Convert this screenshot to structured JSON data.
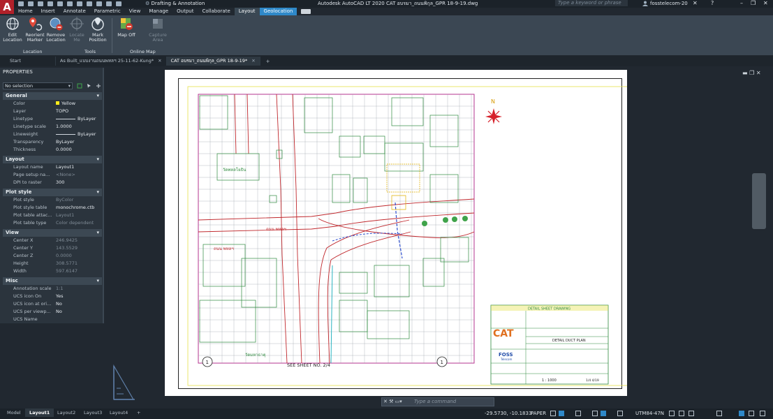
{
  "title_bar": {
    "app_title": "Autodesk AutoCAD LT 2020   CAT อบรมา_ถนนพิกุล_GPR 18-9-19.dwg",
    "workspace": "Drafting & Annotation",
    "search_placeholder": "Type a keyword or phrase",
    "user": "fosstelecom-20",
    "logo_letter": "A"
  },
  "ribbon_tabs": [
    {
      "label": "Home"
    },
    {
      "label": "Insert"
    },
    {
      "label": "Annotate"
    },
    {
      "label": "Parametric"
    },
    {
      "label": "View"
    },
    {
      "label": "Manage"
    },
    {
      "label": "Output"
    },
    {
      "label": "Collaborate"
    },
    {
      "label": "Layout"
    },
    {
      "label": "Geolocation"
    }
  ],
  "ribbon": {
    "edit_location": "Edit\nLocation",
    "reorient_marker": "Reorient\nMarker",
    "remove_location": "Remove\nLocation",
    "locate_me": "Locate\nMe",
    "mark_position": "Mark\nPosition",
    "map_off": "Map Off",
    "capture_area": "Capture\nArea",
    "group_location": "Location",
    "group_tools": "Tools",
    "group_online_map": "Online Map"
  },
  "file_tabs": [
    {
      "label": "Start"
    },
    {
      "label": "As Built_แบบงานถนนพหลฯ 25-11-62-Kung*"
    },
    {
      "label": "CAT อบรมา_ถนนพิกุล_GPR 18-9-19*"
    }
  ],
  "properties": {
    "title": "PROPERTIES",
    "selection": "No selection",
    "sections": [
      {
        "name": "General",
        "rows": [
          {
            "k": "Color",
            "v": "Yellow"
          },
          {
            "k": "Layer",
            "v": "TOPO"
          },
          {
            "k": "Linetype",
            "v": "ByLayer"
          },
          {
            "k": "Linetype scale",
            "v": "1.0000"
          },
          {
            "k": "Lineweight",
            "v": "ByLayer"
          },
          {
            "k": "Transparency",
            "v": "ByLayer"
          },
          {
            "k": "Thickness",
            "v": "0.0000"
          }
        ]
      },
      {
        "name": "Layout",
        "rows": [
          {
            "k": "Layout name",
            "v": "Layout1"
          },
          {
            "k": "Page setup na...",
            "v": "<None>"
          },
          {
            "k": "DPI to raster",
            "v": "300"
          }
        ]
      },
      {
        "name": "Plot style",
        "rows": [
          {
            "k": "Plot style",
            "v": "ByColor"
          },
          {
            "k": "Plot style table",
            "v": "monochrome.ctb"
          },
          {
            "k": "Plot table attac...",
            "v": "Layout1"
          },
          {
            "k": "Plot table type",
            "v": "Color dependent"
          }
        ]
      },
      {
        "name": "View",
        "rows": [
          {
            "k": "Center X",
            "v": "246.9425"
          },
          {
            "k": "Center Y",
            "v": "143.5529"
          },
          {
            "k": "Center Z",
            "v": "0.0000"
          },
          {
            "k": "Height",
            "v": "308.5771"
          },
          {
            "k": "Width",
            "v": "597.6147"
          }
        ]
      },
      {
        "name": "Misc",
        "rows": [
          {
            "k": "Annotation scale",
            "v": "1:1"
          },
          {
            "k": "UCS icon On",
            "v": "Yes"
          },
          {
            "k": "UCS icon at ori...",
            "v": "No"
          },
          {
            "k": "UCS per viewp...",
            "v": "No"
          },
          {
            "k": "UCS Name",
            "v": ""
          }
        ]
      }
    ]
  },
  "drawing": {
    "north": "N",
    "see_sheet": "SEE SHEET NO. 2/4",
    "circle_label": "1",
    "road_label_1": "ถนน พหลฯ",
    "road_label_2": "ถนน พหลฯ",
    "temple_label": "วัดพหลโยธิน",
    "bottom_label": "วัดมหาธาตุ",
    "titleblock_header": "DETAIL SHEET DRAWING",
    "titleblock_plan": "DETAIL DUCT PLAN",
    "cat_logo": "CAT",
    "foss_logo": "FOSS",
    "foss_sub": "Telecom",
    "scale": "1 : 1000",
    "sheet_no": "1/4   4/19"
  },
  "command_line": {
    "placeholder": "Type a command"
  },
  "status_bar": {
    "layout_tabs": [
      {
        "label": "Model"
      },
      {
        "label": "Layout1"
      },
      {
        "label": "Layout2"
      },
      {
        "label": "Layout3"
      },
      {
        "label": "Layout4"
      }
    ],
    "coords": "-29.5730, -10.1833",
    "space": "PAPER",
    "utm": "UTM84-47N"
  }
}
